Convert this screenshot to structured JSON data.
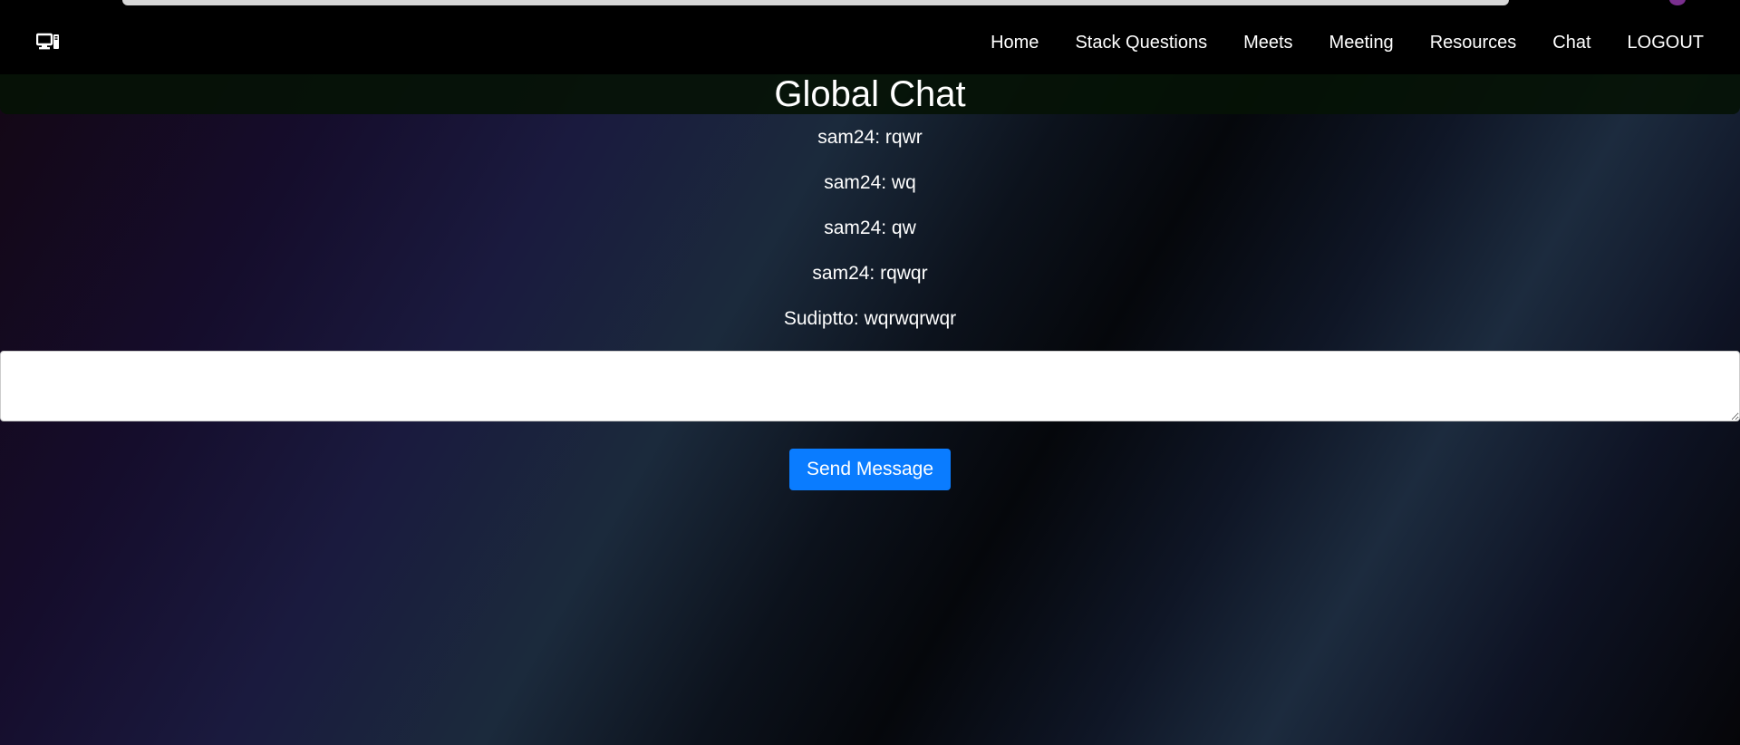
{
  "nav": {
    "brand_icon": "computer-icon",
    "links": [
      "Home",
      "Stack Questions",
      "Meets",
      "Meeting",
      "Resources",
      "Chat",
      "LOGOUT"
    ]
  },
  "page": {
    "title": "Global Chat"
  },
  "messages": [
    "sam24: rqwr",
    "sam24: wq",
    "sam24: qw",
    "sam24: rqwqr",
    "Sudiptto: wqrwqrwqr"
  ],
  "composer": {
    "value": "",
    "send_label": "Send Message"
  },
  "colors": {
    "navbar": "#000000",
    "accent": "#0a7cff",
    "header_band": "#051205"
  }
}
